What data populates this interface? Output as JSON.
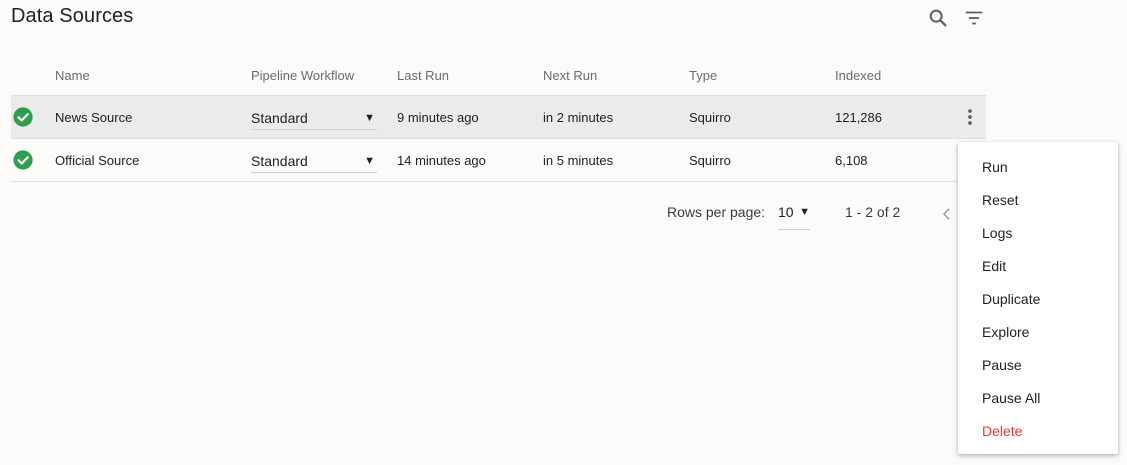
{
  "page": {
    "title": "Data Sources"
  },
  "toolbar": {
    "search_icon": "search-icon",
    "filter_icon": "filter-icon"
  },
  "table": {
    "columns": [
      "",
      "Name",
      "Pipeline Workflow",
      "Last Run",
      "Next Run",
      "Type",
      "Indexed",
      ""
    ],
    "rows": [
      {
        "status": "success",
        "name": "News Source",
        "workflow": "Standard",
        "last_run": "9 minutes ago",
        "next_run": "in 2 minutes",
        "type": "Squirro",
        "indexed": "121,286"
      },
      {
        "status": "success",
        "name": "Official Source",
        "workflow": "Standard",
        "last_run": "14 minutes ago",
        "next_run": "in 5 minutes",
        "type": "Squirro",
        "indexed": "6,108"
      }
    ]
  },
  "pagination": {
    "rows_label": "Rows per page:",
    "rows_value": "10",
    "range": "1 - 2 of 2"
  },
  "menu": {
    "items": [
      "Run",
      "Reset",
      "Logs",
      "Edit",
      "Duplicate",
      "Explore",
      "Pause",
      "Pause All",
      "Delete"
    ]
  },
  "colors": {
    "success": "#2e9e4f",
    "danger": "#e53935",
    "row_highlight": "#ebebeb"
  }
}
